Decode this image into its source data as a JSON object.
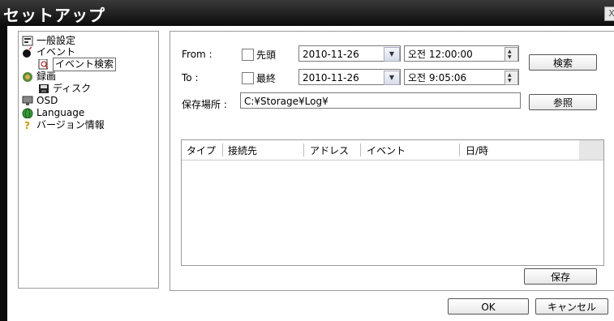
{
  "window": {
    "title": "セットアップ",
    "close_glyph": "X"
  },
  "tree": {
    "items": [
      {
        "label": "一般設定",
        "icon": "settings-icon"
      },
      {
        "label": "イベント",
        "icon": "bomb-icon"
      },
      {
        "label": "イベント検索",
        "icon": "search-doc-icon",
        "selected": true
      },
      {
        "label": "録画",
        "icon": "recording-icon"
      },
      {
        "label": "ディスク",
        "icon": "disk-icon"
      },
      {
        "label": "OSD",
        "icon": "osd-icon"
      },
      {
        "label": "Language",
        "icon": "globe-icon"
      },
      {
        "label": "バージョン情報",
        "icon": "question-icon"
      }
    ]
  },
  "search": {
    "from_label": "From :",
    "to_label": "To :",
    "from_check_label": "先頭",
    "to_check_label": "最終",
    "from_date": "2010-11-26",
    "to_date": "2010-11-26",
    "from_time": "오전 12:00:00",
    "to_time": "오전  9:05:06",
    "search_button": "検索",
    "location_label": "保存場所 :",
    "location_value": "C:¥Storage¥Log¥",
    "browse_button": "参照"
  },
  "table": {
    "columns": [
      "タイプ",
      "接続先",
      "アドレス",
      "イベント",
      "日/時"
    ],
    "rows": []
  },
  "buttons": {
    "save": "保存",
    "ok": "OK",
    "cancel": "キャンセル"
  }
}
